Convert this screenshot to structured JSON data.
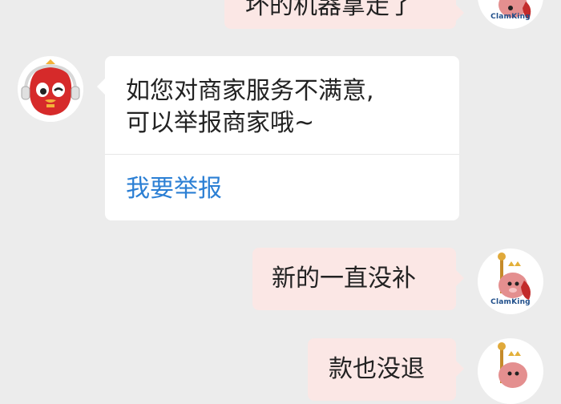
{
  "messages": {
    "top_outgoing": "坏的机器拿走了",
    "bot_card": {
      "line1": "如您对商家服务不满意,",
      "line2": "可以举报商家哦~",
      "action_link": "我要举报"
    },
    "outgoing_1": "新的一直没补",
    "outgoing_2": "款也没退"
  },
  "user_avatar": {
    "brand": "ClamKing"
  },
  "colors": {
    "background": "#ececec",
    "outgoing_bubble": "#fbe7e5",
    "incoming_card": "#ffffff",
    "link": "#2b7fd4",
    "bot_avatar_red": "#d62a2a"
  },
  "icons": {
    "bot_avatar": "red-bird-headset-icon",
    "user_avatar": "clamking-mascot-icon"
  }
}
